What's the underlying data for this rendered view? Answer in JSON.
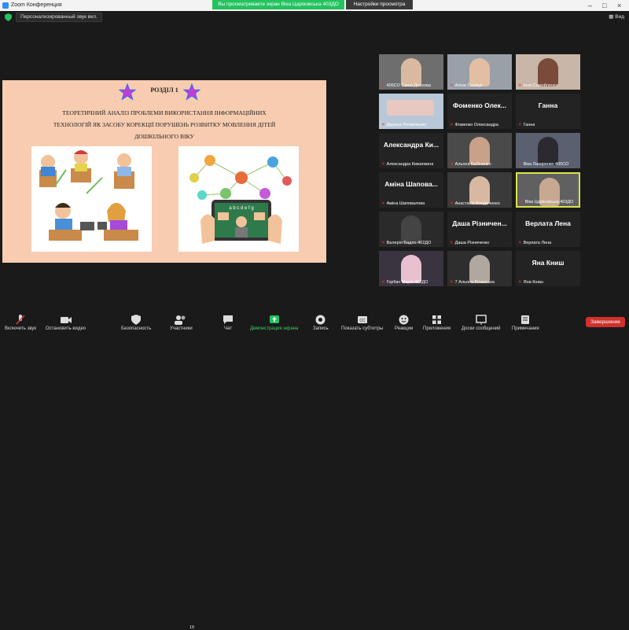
{
  "window": {
    "title": "Zoom Конференция"
  },
  "banner": {
    "sharing_text": "Вы просматриваете экран Віка Царіковська 403ДО",
    "view_settings": "Настройки просмотра"
  },
  "topbar": {
    "audio": "Персонализированный звук вкл.",
    "view": "Вид"
  },
  "slide": {
    "heading": "РОЗДІЛ 1",
    "body_lines": [
      "ТЕОРЕТИЧНИЙ АНАЛІЗ ПРОБЛЕМИ ВИКОРИСТАННЯ ІНФОРМАЦІЙНИХ",
      "ТЕХНОЛОГІЙ ЯК ЗАСОБУ КОРЕКЦІЇ ПОРУШЕНЬ РОЗВИТКУ МОВЛЕННЯ ДІТЕЙ",
      "ДОШКІЛЬНОГО ВІКУ"
    ],
    "tablet_text": "a b c d e f g"
  },
  "participants": [
    {
      "label": "405СО Саша Деяхова",
      "name": ""
    },
    {
      "label": "Аліна Синиця",
      "name": ""
    },
    {
      "label": "Інна Самойленко",
      "name": ""
    },
    {
      "label": "Дарина Литвиненко",
      "name": ""
    },
    {
      "label": "Фоменко Олександра",
      "name": "Фоменко Олек..."
    },
    {
      "label": "Ганна",
      "name": "Ганна"
    },
    {
      "label": "Александра Кижапкина",
      "name": "Александра Ки..."
    },
    {
      "label": "Альона Бабіченко",
      "name": ""
    },
    {
      "label": "Віка Лазаренко 405СО",
      "name": ""
    },
    {
      "label": "Аміна Шаповалова",
      "name": "Аміна Шапова..."
    },
    {
      "label": "Анастасія Владиченко",
      "name": ""
    },
    {
      "label": "Віка Царіковська 403ДО",
      "name": ""
    },
    {
      "label": "Валерія Бадло 402ДО",
      "name": ""
    },
    {
      "label": "Даша Різниченко",
      "name": "Даша Різничен..."
    },
    {
      "label": "Верлата Лена",
      "name": "Верлата Лена"
    },
    {
      "label": "Горбач Марія 402ДО",
      "name": ""
    },
    {
      "label": "7 Альона Біланська",
      "name": ""
    },
    {
      "label": "Яна Книш",
      "name": "Яна Книш"
    }
  ],
  "toolbar": {
    "mute": "Включить звук",
    "video": "Остановить видео",
    "security": "Безопасность",
    "participants": "Участники",
    "participants_count": "18",
    "chat": "Чат",
    "share": "Демонстрация экрана",
    "record": "Запись",
    "captions": "Показать субтитры",
    "reactions": "Реакции",
    "apps": "Приложения",
    "whiteboard": "Доски сообщений",
    "notes": "Примечания",
    "end": "Завершение"
  },
  "colors": {
    "share_green": "#23c35f",
    "end_red": "#d0312d",
    "active_border": "#d9e34b",
    "slide_bg": "#f8ccb0"
  }
}
